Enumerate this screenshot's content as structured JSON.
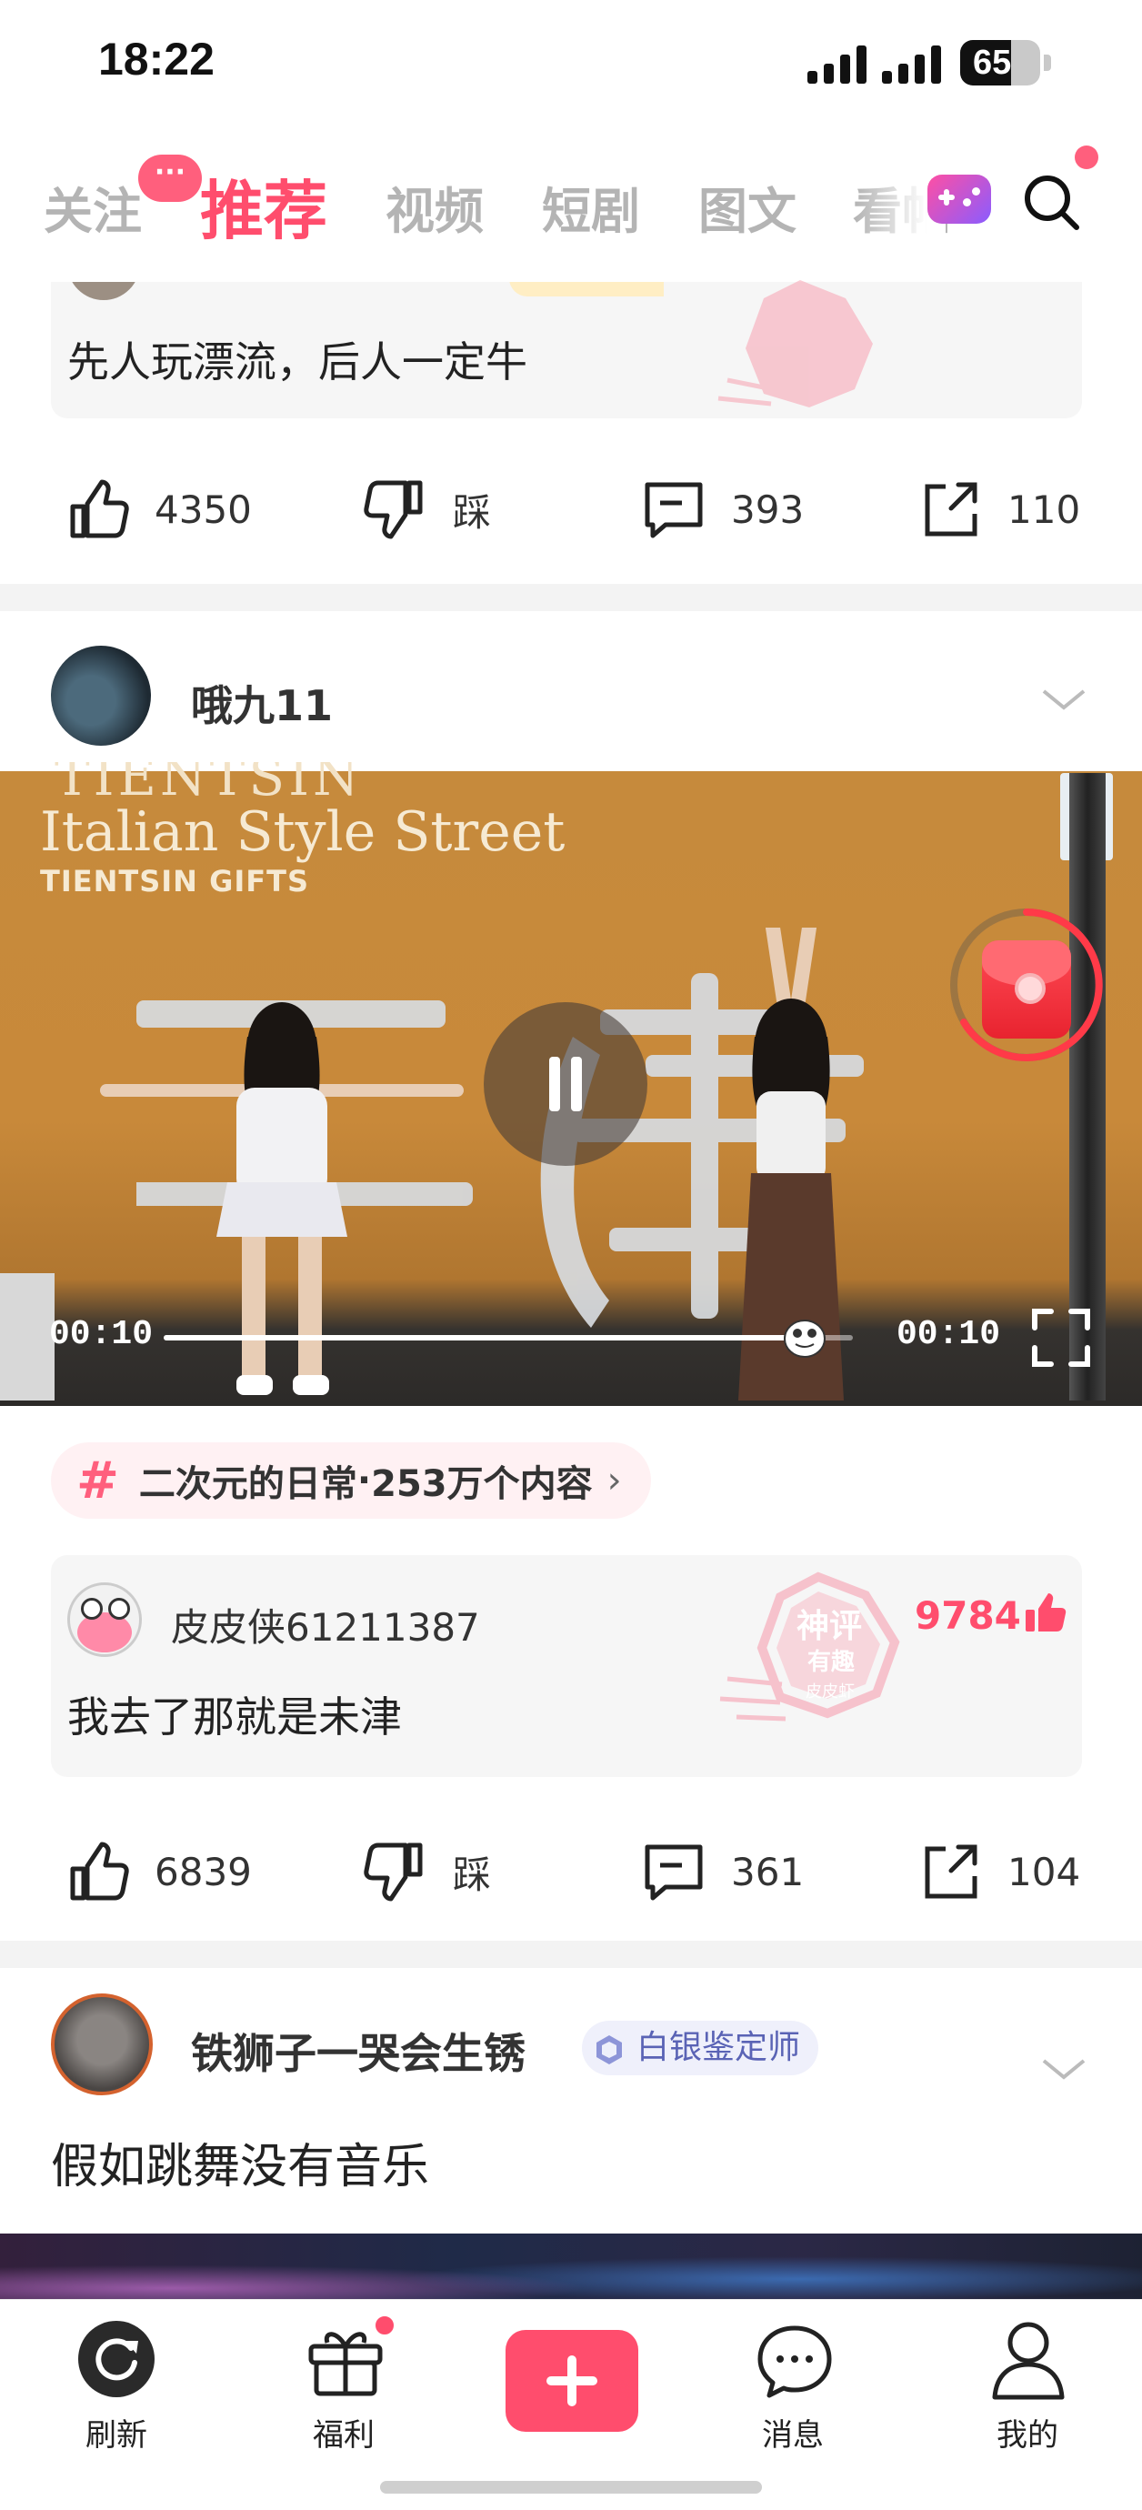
{
  "status_bar": {
    "time": "18:22",
    "battery": "65"
  },
  "top_tabs": {
    "items": [
      "关注",
      "推荐",
      "视频",
      "短剧",
      "图文",
      "看帖"
    ],
    "active": "推荐",
    "badge": "···"
  },
  "post1": {
    "comment_text": "先人玩漂流，后人一定牛",
    "actions": {
      "likes": "4350",
      "dislike_label": "踩",
      "comments": "393",
      "shares": "110"
    }
  },
  "post2": {
    "username": "哦九11",
    "video": {
      "overlay_line1": "TIENTSIN",
      "overlay_line2": "Italian Style Street",
      "overlay_line3": "TIENTSIN GIFTS",
      "elapsed": "00:10",
      "duration": "00:10",
      "progress": 0.93
    },
    "topic": {
      "name": "二次元的日常",
      "separator": " · ",
      "count": "253万个内容",
      "arrow": "›"
    },
    "hot_comment": {
      "username": "皮皮侠61211387",
      "text": "我去了那就是未津",
      "likes": "9784",
      "stamp": {
        "line1": "神评",
        "line2": "有趣",
        "line3": "皮皮虾"
      }
    },
    "actions": {
      "likes": "6839",
      "dislike_label": "踩",
      "comments": "361",
      "shares": "104"
    }
  },
  "post3": {
    "username": "铁狮子一哭会生锈",
    "badge": "白银鉴定师",
    "title": "假如跳舞没有音乐"
  },
  "bottom_nav": {
    "items": [
      {
        "label": "刷新",
        "icon": "refresh-icon"
      },
      {
        "label": "福利",
        "icon": "gift-icon"
      },
      {
        "label": "",
        "icon": "plus-icon"
      },
      {
        "label": "消息",
        "icon": "message-icon"
      },
      {
        "label": "我的",
        "icon": "profile-icon"
      }
    ]
  },
  "colors": {
    "accent": "#ff4d6d",
    "tab_inactive": "#b4b4b4",
    "divider": "#f3f3f3"
  }
}
